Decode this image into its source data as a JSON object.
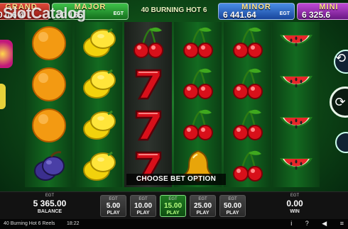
{
  "jackpots": {
    "grand": {
      "name": "GRAND",
      "value": "0 0 6 4",
      "currency": ""
    },
    "major": {
      "name": "MAJOR",
      "value": "30 165",
      "currency": "EGT"
    },
    "minor": {
      "name": "MINOR",
      "value": "6 441.64",
      "currency": "EGT"
    },
    "mini": {
      "name": "MINI",
      "value": "6 325.6",
      "currency": "EGT"
    }
  },
  "game_title": "40 BURNING HOT 6",
  "watermark": "SlotCatalog",
  "reels": [
    [
      "orange-icon",
      "orange-icon",
      "orange-icon",
      "plum-icon"
    ],
    [
      "lemon-icon",
      "lemon-icon",
      "lemon-icon",
      "lemon-icon"
    ],
    [
      "cherry-icon",
      "seven-icon",
      "seven-icon",
      "seven-icon"
    ],
    [
      "cherry-icon",
      "cherry-icon",
      "cherry-icon",
      "bell-icon"
    ],
    [
      "cherry-icon",
      "cherry-icon",
      "cherry-icon",
      "cherry-icon"
    ],
    [
      "watermelon-icon",
      "watermelon-icon",
      "watermelon-icon",
      "watermelon-icon"
    ]
  ],
  "prompt": "CHOOSE BET OPTION",
  "balance": {
    "brand": "EGT",
    "value": "5 365.00",
    "label": "BALANCE"
  },
  "win": {
    "brand": "EGT",
    "value": "0.00",
    "label": "WIN"
  },
  "bets": [
    {
      "brand": "EGT",
      "value": "5.00",
      "label": "PLAY"
    },
    {
      "brand": "EGT",
      "value": "10.00",
      "label": "PLAY"
    },
    {
      "brand": "EGT",
      "value": "15.00",
      "label": "PLAY",
      "active": true
    },
    {
      "brand": "EGT",
      "value": "25.00",
      "label": "PLAY"
    },
    {
      "brand": "EGT",
      "value": "50.00",
      "label": "PLAY"
    }
  ],
  "footer": {
    "title": "40 Burning Hot 6 Reels",
    "time": "18:22",
    "icons": [
      "info-icon",
      "help-icon",
      "volume-icon",
      "menu-icon"
    ],
    "icon_glyphs": [
      "i",
      "?",
      "◀",
      "≡"
    ]
  },
  "colors": {
    "table_green": "#136a20",
    "active_bet": "#1f7a22"
  }
}
